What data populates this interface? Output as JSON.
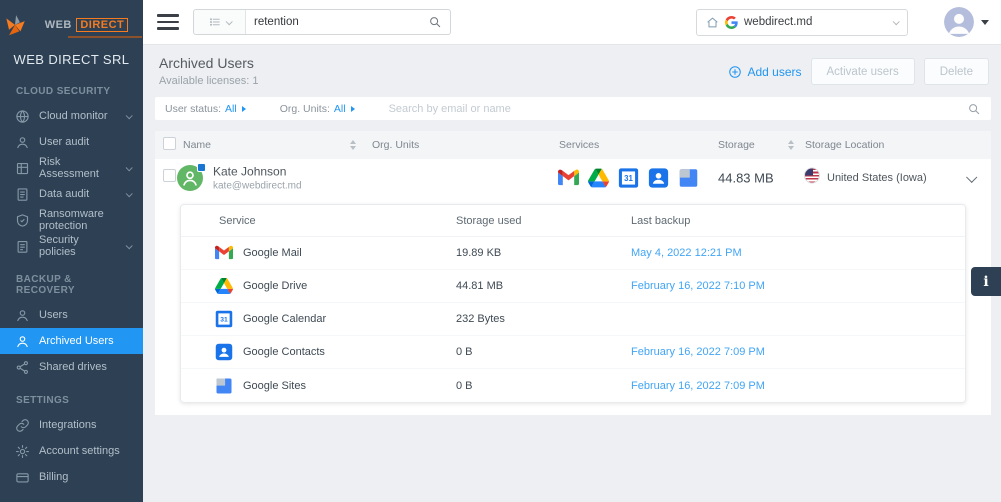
{
  "brand": {
    "logo_text_web": "WEB",
    "logo_text_direct": "DIRECT",
    "company_name": "WEB DIRECT SRL"
  },
  "topbar": {
    "search_value": "retention",
    "domain_value": "webdirect.md"
  },
  "sidebar": {
    "sections": [
      {
        "label": "CLOUD SECURITY",
        "items": [
          {
            "label": "Cloud monitor",
            "icon": "globe-icon",
            "expandable": true
          },
          {
            "label": "User audit",
            "icon": "person-icon",
            "expandable": false
          },
          {
            "label": "Risk Assessment",
            "icon": "grid-icon",
            "expandable": true
          },
          {
            "label": "Data audit",
            "icon": "document-icon",
            "expandable": true
          },
          {
            "label": "Ransomware protection",
            "icon": "shield-icon",
            "expandable": false
          },
          {
            "label": "Security policies",
            "icon": "policy-icon",
            "expandable": true
          }
        ]
      },
      {
        "label": "BACKUP & RECOVERY",
        "items": [
          {
            "label": "Users",
            "icon": "person-icon",
            "expandable": false
          },
          {
            "label": "Archived Users",
            "icon": "person-icon",
            "expandable": false,
            "active": true
          },
          {
            "label": "Shared drives",
            "icon": "share-icon",
            "expandable": false
          }
        ]
      },
      {
        "label": "SETTINGS",
        "items": [
          {
            "label": "Integrations",
            "icon": "link-icon",
            "expandable": false
          },
          {
            "label": "Account settings",
            "icon": "gear-icon",
            "expandable": false
          },
          {
            "label": "Billing",
            "icon": "credit-card-icon",
            "expandable": false
          }
        ]
      }
    ]
  },
  "page": {
    "title": "Archived Users",
    "subtitle": "Available licenses: 1",
    "actions": {
      "add_users": "Add users",
      "activate_users": "Activate users",
      "delete": "Delete"
    }
  },
  "filters": {
    "user_status_label": "User status:",
    "user_status_value": "All",
    "org_units_label": "Org. Units:",
    "org_units_value": "All",
    "search_placeholder": "Search by email or name"
  },
  "table": {
    "columns": {
      "name": "Name",
      "org_units": "Org. Units",
      "services": "Services",
      "storage": "Storage",
      "storage_location": "Storage Location"
    },
    "row": {
      "name": "Kate Johnson",
      "email": "kate@webdirect.md",
      "service_icons": [
        "google-mail-icon",
        "google-drive-icon",
        "google-calendar-icon",
        "google-contacts-icon",
        "google-sites-icon"
      ],
      "storage": "44.83 MB",
      "storage_location": "United States (Iowa)"
    }
  },
  "details": {
    "columns": {
      "service": "Service",
      "storage_used": "Storage used",
      "last_backup": "Last backup"
    },
    "rows": [
      {
        "service": "Google Mail",
        "icon": "google-mail-icon",
        "storage_used": "19.89 KB",
        "last_backup": "May 4, 2022 12:21 PM"
      },
      {
        "service": "Google Drive",
        "icon": "google-drive-icon",
        "storage_used": "44.81 MB",
        "last_backup": "February 16, 2022 7:10 PM"
      },
      {
        "service": "Google Calendar",
        "icon": "google-calendar-icon",
        "storage_used": "232 Bytes",
        "last_backup": ""
      },
      {
        "service": "Google Contacts",
        "icon": "google-contacts-icon",
        "storage_used": "0 B",
        "last_backup": "February 16, 2022 7:09 PM"
      },
      {
        "service": "Google Sites",
        "icon": "google-sites-icon",
        "storage_used": "0 B",
        "last_backup": "February 16, 2022 7:09 PM"
      }
    ]
  },
  "info_tab": {
    "label": "i"
  },
  "colors": {
    "accent_blue": "#2196f3",
    "link_blue": "#42a5f5",
    "sidebar_bg": "#2e4154",
    "active_item_bg": "#2196f3",
    "page_bg": "#edeff2",
    "brand_orange": "#f47b20",
    "avatar_green": "#62b766"
  }
}
